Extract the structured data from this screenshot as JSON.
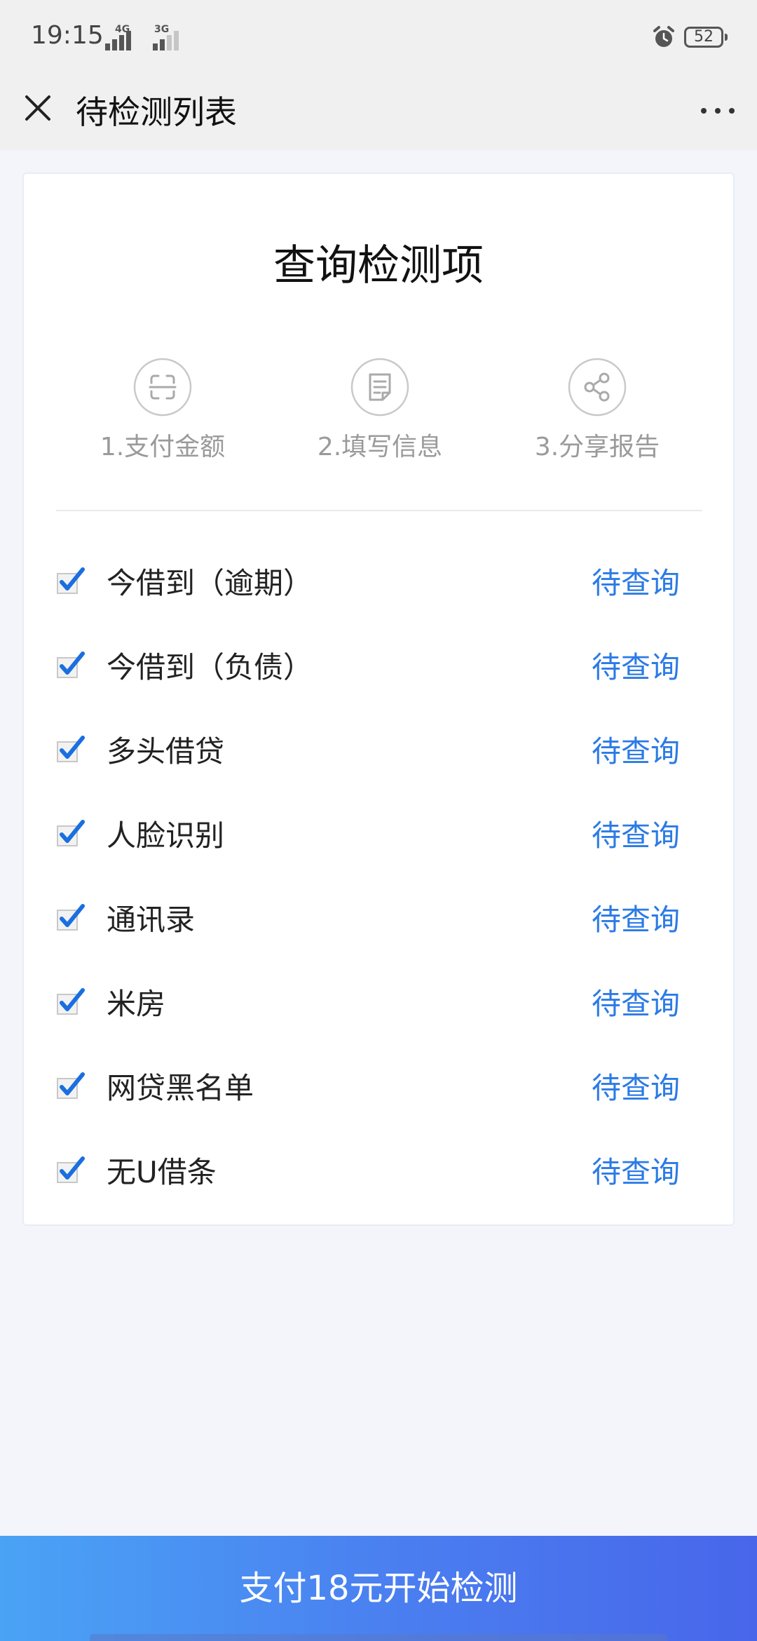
{
  "status_bar": {
    "time": "19:15",
    "signal1_tag": "4G",
    "signal2_tag": "3G",
    "battery": "52"
  },
  "header": {
    "title": "待检测列表"
  },
  "card": {
    "title": "查询检测项",
    "steps": [
      {
        "label": "1.支付金额",
        "icon": "scan-icon"
      },
      {
        "label": "2.填写信息",
        "icon": "form-icon"
      },
      {
        "label": "3.分享报告",
        "icon": "share-icon"
      }
    ],
    "items": [
      {
        "label": "今借到（逾期）",
        "status": "待查询",
        "checked": true
      },
      {
        "label": "今借到（负债）",
        "status": "待查询",
        "checked": true
      },
      {
        "label": "多头借贷",
        "status": "待查询",
        "checked": true
      },
      {
        "label": "人脸识别",
        "status": "待查询",
        "checked": true
      },
      {
        "label": "通讯录",
        "status": "待查询",
        "checked": true
      },
      {
        "label": "米房",
        "status": "待查询",
        "checked": true
      },
      {
        "label": "网贷黑名单",
        "status": "待查询",
        "checked": true
      },
      {
        "label": "无U借条",
        "status": "待查询",
        "checked": true
      }
    ]
  },
  "pay_button": {
    "label": "支付18元开始检测"
  },
  "colors": {
    "accent": "#2c7be5",
    "checkbox": "#1a6fe0",
    "button_start": "#4aa3f5",
    "button_end": "#4866ea"
  }
}
